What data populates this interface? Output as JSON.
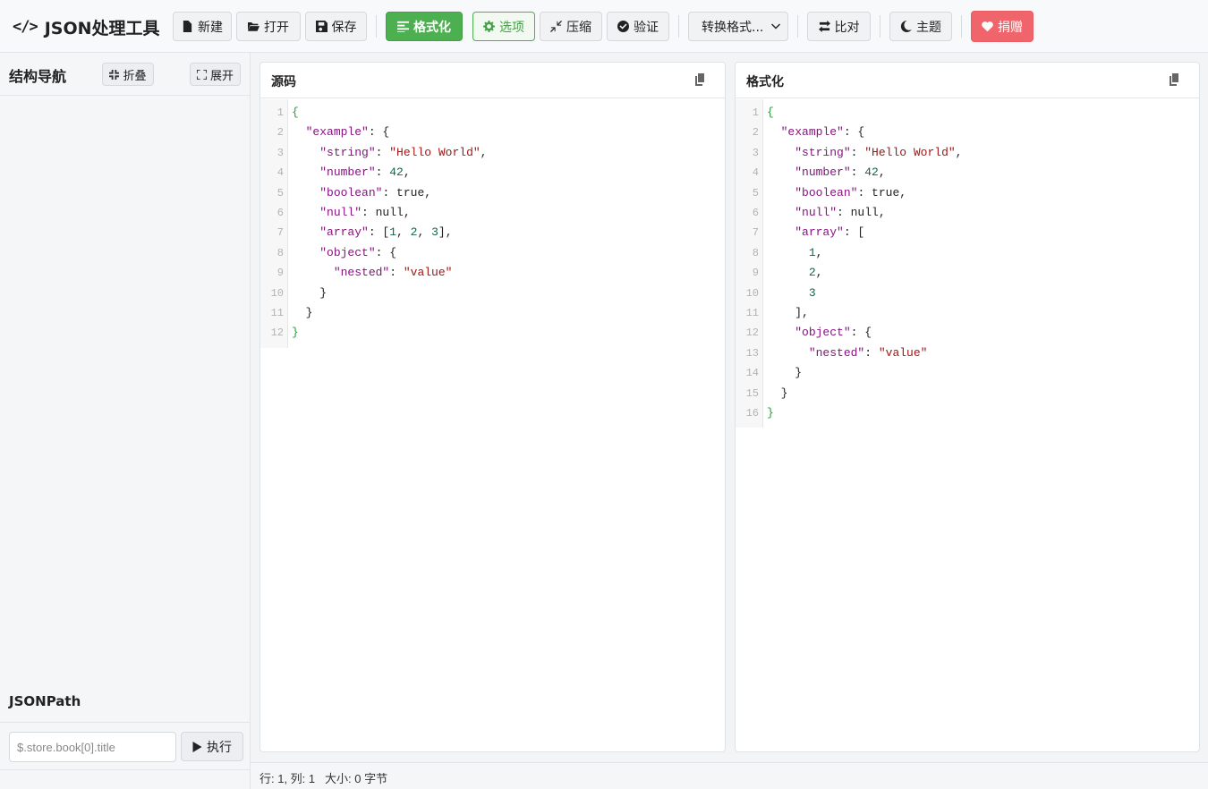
{
  "app": {
    "title": "JSON处理工具",
    "brand_icon": "code-icon"
  },
  "toolbar": {
    "new_label": "新建",
    "open_label": "打开",
    "save_label": "保存",
    "format_label": "格式化",
    "options_label": "选项",
    "compress_label": "压缩",
    "validate_label": "验证",
    "convert_select": "转换格式...",
    "compare_label": "比对",
    "theme_label": "主题",
    "donate_label": "捐赠"
  },
  "colors": {
    "primary_green": "#4caf50",
    "donate_red": "#f0646b"
  },
  "sidebar": {
    "title": "结构导航",
    "collapse_label": "折叠",
    "expand_label": "展开",
    "jsonpath_title": "JSONPath",
    "jsonpath_placeholder": "$.store.book[0].title",
    "execute_label": "执行"
  },
  "source_panel": {
    "title": "源码",
    "lines": [
      [
        [
          "p",
          "{"
        ]
      ],
      [
        [
          "t",
          "  "
        ],
        [
          "k",
          "\"example\""
        ],
        [
          "t",
          ": {"
        ]
      ],
      [
        [
          "t",
          "    "
        ],
        [
          "k",
          "\"string\""
        ],
        [
          "t",
          ": "
        ],
        [
          "s",
          "\"Hello World\""
        ],
        [
          "t",
          ","
        ]
      ],
      [
        [
          "t",
          "    "
        ],
        [
          "k",
          "\"number\""
        ],
        [
          "t",
          ": "
        ],
        [
          "n",
          "42"
        ],
        [
          "t",
          ","
        ]
      ],
      [
        [
          "t",
          "    "
        ],
        [
          "k",
          "\"boolean\""
        ],
        [
          "t",
          ": true,"
        ]
      ],
      [
        [
          "t",
          "    "
        ],
        [
          "k",
          "\"null\""
        ],
        [
          "t",
          ": null,"
        ]
      ],
      [
        [
          "t",
          "    "
        ],
        [
          "k",
          "\"array\""
        ],
        [
          "t",
          ": ["
        ],
        [
          "n",
          "1"
        ],
        [
          "t",
          ", "
        ],
        [
          "n",
          "2"
        ],
        [
          "t",
          ", "
        ],
        [
          "n",
          "3"
        ],
        [
          "t",
          "],"
        ]
      ],
      [
        [
          "t",
          "    "
        ],
        [
          "k",
          "\"object\""
        ],
        [
          "t",
          ": {"
        ]
      ],
      [
        [
          "t",
          "      "
        ],
        [
          "k",
          "\"nested\""
        ],
        [
          "t",
          ": "
        ],
        [
          "s",
          "\"value\""
        ]
      ],
      [
        [
          "t",
          "    }"
        ]
      ],
      [
        [
          "t",
          "  }"
        ]
      ],
      [
        [
          "p",
          "}"
        ]
      ]
    ]
  },
  "formatted_panel": {
    "title": "格式化",
    "lines": [
      [
        [
          "p",
          "{"
        ]
      ],
      [
        [
          "t",
          "  "
        ],
        [
          "k",
          "\"example\""
        ],
        [
          "t",
          ": {"
        ]
      ],
      [
        [
          "t",
          "    "
        ],
        [
          "k",
          "\"string\""
        ],
        [
          "t",
          ": "
        ],
        [
          "s",
          "\"Hello World\""
        ],
        [
          "t",
          ","
        ]
      ],
      [
        [
          "t",
          "    "
        ],
        [
          "k",
          "\"number\""
        ],
        [
          "t",
          ": "
        ],
        [
          "n",
          "42"
        ],
        [
          "t",
          ","
        ]
      ],
      [
        [
          "t",
          "    "
        ],
        [
          "k",
          "\"boolean\""
        ],
        [
          "t",
          ": true,"
        ]
      ],
      [
        [
          "t",
          "    "
        ],
        [
          "k",
          "\"null\""
        ],
        [
          "t",
          ": null,"
        ]
      ],
      [
        [
          "t",
          "    "
        ],
        [
          "k",
          "\"array\""
        ],
        [
          "t",
          ": ["
        ]
      ],
      [
        [
          "t",
          "      "
        ],
        [
          "n",
          "1"
        ],
        [
          "t",
          ","
        ]
      ],
      [
        [
          "t",
          "      "
        ],
        [
          "n",
          "2"
        ],
        [
          "t",
          ","
        ]
      ],
      [
        [
          "t",
          "      "
        ],
        [
          "n",
          "3"
        ]
      ],
      [
        [
          "t",
          "    ],"
        ]
      ],
      [
        [
          "t",
          "    "
        ],
        [
          "k",
          "\"object\""
        ],
        [
          "t",
          ": {"
        ]
      ],
      [
        [
          "t",
          "      "
        ],
        [
          "k",
          "\"nested\""
        ],
        [
          "t",
          ": "
        ],
        [
          "s",
          "\"value\""
        ]
      ],
      [
        [
          "t",
          "    }"
        ]
      ],
      [
        [
          "t",
          "  }"
        ]
      ],
      [
        [
          "p",
          "}"
        ]
      ]
    ]
  },
  "status": {
    "position": "行: 1, 列: 1",
    "size": "大小: 0 字节"
  }
}
